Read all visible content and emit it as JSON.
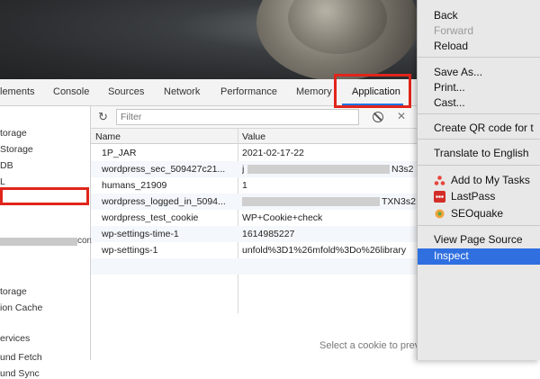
{
  "tabs": [
    "lements",
    "Console",
    "Sources",
    "Network",
    "Performance",
    "Memory",
    "Application"
  ],
  "sidebar": {
    "items": [
      "torage",
      "Storage",
      "DB",
      "L",
      "torage",
      "ion Cache",
      "ervices",
      "und Fetch",
      "und Sync"
    ],
    "suffix": "con"
  },
  "filter": {
    "placeholder": "Filter"
  },
  "table": {
    "columns": [
      "Name",
      "Value"
    ],
    "rows": [
      {
        "name": "1P_JAR",
        "value": "2021-02-17-22"
      },
      {
        "name": "wordpress_sec_509427c21...",
        "value": "j",
        "tail": "N3s2"
      },
      {
        "name": "humans_21909",
        "value": "1"
      },
      {
        "name": "wordpress_logged_in_5094...",
        "value": "",
        "tail": "TXN3s2"
      },
      {
        "name": "wordpress_test_cookie",
        "value": "WP+Cookie+check"
      },
      {
        "name": "wp-settings-time-1",
        "value": "1614985227"
      },
      {
        "name": "wp-settings-1",
        "value": "unfold%3D1%26mfold%3Do%26library"
      }
    ]
  },
  "bottom_text": "Select a cookie to preview its value",
  "context_menu": {
    "back": "Back",
    "forward": "Forward",
    "reload": "Reload",
    "save_as": "Save As...",
    "print": "Print...",
    "cast": "Cast...",
    "qr": "Create QR code for t",
    "translate": "Translate to English",
    "add_tasks": "Add to My Tasks",
    "lastpass": "LastPass",
    "seoquake": "SEOquake",
    "view_source": "View Page Source",
    "inspect": "Inspect"
  },
  "colors": {
    "highlight": "#e0251b",
    "selection": "#2f6fe0"
  }
}
